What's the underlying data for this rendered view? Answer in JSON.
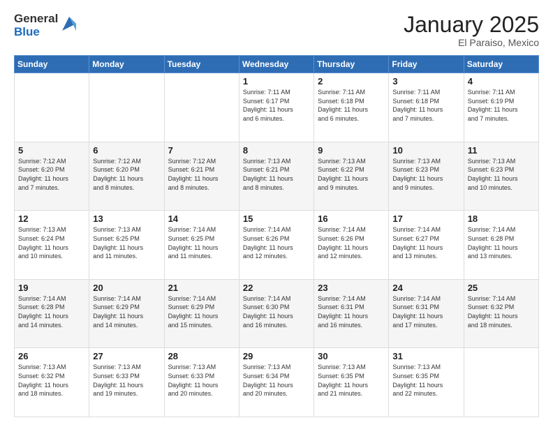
{
  "header": {
    "logo_general": "General",
    "logo_blue": "Blue",
    "title": "January 2025",
    "location": "El Paraiso, Mexico"
  },
  "days_of_week": [
    "Sunday",
    "Monday",
    "Tuesday",
    "Wednesday",
    "Thursday",
    "Friday",
    "Saturday"
  ],
  "weeks": [
    [
      {
        "day": "",
        "info": ""
      },
      {
        "day": "",
        "info": ""
      },
      {
        "day": "",
        "info": ""
      },
      {
        "day": "1",
        "info": "Sunrise: 7:11 AM\nSunset: 6:17 PM\nDaylight: 11 hours\nand 6 minutes."
      },
      {
        "day": "2",
        "info": "Sunrise: 7:11 AM\nSunset: 6:18 PM\nDaylight: 11 hours\nand 6 minutes."
      },
      {
        "day": "3",
        "info": "Sunrise: 7:11 AM\nSunset: 6:18 PM\nDaylight: 11 hours\nand 7 minutes."
      },
      {
        "day": "4",
        "info": "Sunrise: 7:11 AM\nSunset: 6:19 PM\nDaylight: 11 hours\nand 7 minutes."
      }
    ],
    [
      {
        "day": "5",
        "info": "Sunrise: 7:12 AM\nSunset: 6:20 PM\nDaylight: 11 hours\nand 7 minutes."
      },
      {
        "day": "6",
        "info": "Sunrise: 7:12 AM\nSunset: 6:20 PM\nDaylight: 11 hours\nand 8 minutes."
      },
      {
        "day": "7",
        "info": "Sunrise: 7:12 AM\nSunset: 6:21 PM\nDaylight: 11 hours\nand 8 minutes."
      },
      {
        "day": "8",
        "info": "Sunrise: 7:13 AM\nSunset: 6:21 PM\nDaylight: 11 hours\nand 8 minutes."
      },
      {
        "day": "9",
        "info": "Sunrise: 7:13 AM\nSunset: 6:22 PM\nDaylight: 11 hours\nand 9 minutes."
      },
      {
        "day": "10",
        "info": "Sunrise: 7:13 AM\nSunset: 6:23 PM\nDaylight: 11 hours\nand 9 minutes."
      },
      {
        "day": "11",
        "info": "Sunrise: 7:13 AM\nSunset: 6:23 PM\nDaylight: 11 hours\nand 10 minutes."
      }
    ],
    [
      {
        "day": "12",
        "info": "Sunrise: 7:13 AM\nSunset: 6:24 PM\nDaylight: 11 hours\nand 10 minutes."
      },
      {
        "day": "13",
        "info": "Sunrise: 7:13 AM\nSunset: 6:25 PM\nDaylight: 11 hours\nand 11 minutes."
      },
      {
        "day": "14",
        "info": "Sunrise: 7:14 AM\nSunset: 6:25 PM\nDaylight: 11 hours\nand 11 minutes."
      },
      {
        "day": "15",
        "info": "Sunrise: 7:14 AM\nSunset: 6:26 PM\nDaylight: 11 hours\nand 12 minutes."
      },
      {
        "day": "16",
        "info": "Sunrise: 7:14 AM\nSunset: 6:26 PM\nDaylight: 11 hours\nand 12 minutes."
      },
      {
        "day": "17",
        "info": "Sunrise: 7:14 AM\nSunset: 6:27 PM\nDaylight: 11 hours\nand 13 minutes."
      },
      {
        "day": "18",
        "info": "Sunrise: 7:14 AM\nSunset: 6:28 PM\nDaylight: 11 hours\nand 13 minutes."
      }
    ],
    [
      {
        "day": "19",
        "info": "Sunrise: 7:14 AM\nSunset: 6:28 PM\nDaylight: 11 hours\nand 14 minutes."
      },
      {
        "day": "20",
        "info": "Sunrise: 7:14 AM\nSunset: 6:29 PM\nDaylight: 11 hours\nand 14 minutes."
      },
      {
        "day": "21",
        "info": "Sunrise: 7:14 AM\nSunset: 6:29 PM\nDaylight: 11 hours\nand 15 minutes."
      },
      {
        "day": "22",
        "info": "Sunrise: 7:14 AM\nSunset: 6:30 PM\nDaylight: 11 hours\nand 16 minutes."
      },
      {
        "day": "23",
        "info": "Sunrise: 7:14 AM\nSunset: 6:31 PM\nDaylight: 11 hours\nand 16 minutes."
      },
      {
        "day": "24",
        "info": "Sunrise: 7:14 AM\nSunset: 6:31 PM\nDaylight: 11 hours\nand 17 minutes."
      },
      {
        "day": "25",
        "info": "Sunrise: 7:14 AM\nSunset: 6:32 PM\nDaylight: 11 hours\nand 18 minutes."
      }
    ],
    [
      {
        "day": "26",
        "info": "Sunrise: 7:13 AM\nSunset: 6:32 PM\nDaylight: 11 hours\nand 18 minutes."
      },
      {
        "day": "27",
        "info": "Sunrise: 7:13 AM\nSunset: 6:33 PM\nDaylight: 11 hours\nand 19 minutes."
      },
      {
        "day": "28",
        "info": "Sunrise: 7:13 AM\nSunset: 6:33 PM\nDaylight: 11 hours\nand 20 minutes."
      },
      {
        "day": "29",
        "info": "Sunrise: 7:13 AM\nSunset: 6:34 PM\nDaylight: 11 hours\nand 20 minutes."
      },
      {
        "day": "30",
        "info": "Sunrise: 7:13 AM\nSunset: 6:35 PM\nDaylight: 11 hours\nand 21 minutes."
      },
      {
        "day": "31",
        "info": "Sunrise: 7:13 AM\nSunset: 6:35 PM\nDaylight: 11 hours\nand 22 minutes."
      },
      {
        "day": "",
        "info": ""
      }
    ]
  ]
}
